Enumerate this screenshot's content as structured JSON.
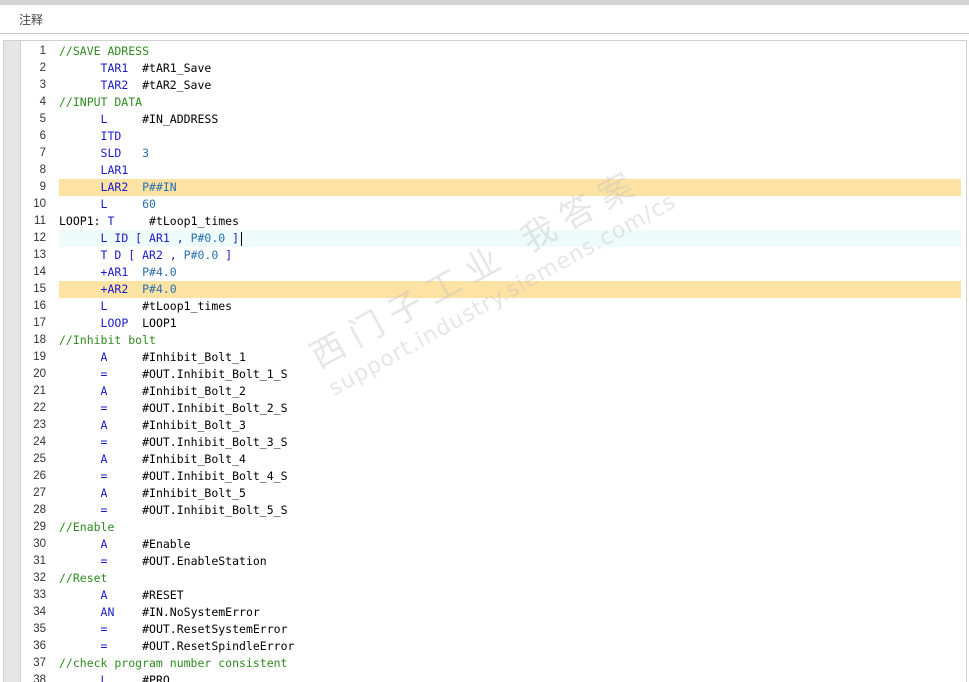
{
  "comment": {
    "label": "注释"
  },
  "code_lines": [
    {
      "n": "1",
      "seg": [
        {
          "t": "//SAVE ADRESS",
          "c": "comment"
        }
      ]
    },
    {
      "n": "2",
      "seg": [
        {
          "t": "      ",
          "c": "txt"
        },
        {
          "t": "TAR1",
          "c": "kw"
        },
        {
          "t": "  #tAR1_Save",
          "c": "txt"
        }
      ]
    },
    {
      "n": "3",
      "seg": [
        {
          "t": "      ",
          "c": "txt"
        },
        {
          "t": "TAR2",
          "c": "kw"
        },
        {
          "t": "  #tAR2_Save",
          "c": "txt"
        }
      ]
    },
    {
      "n": "4",
      "seg": [
        {
          "t": "//INPUT DATA",
          "c": "comment"
        }
      ]
    },
    {
      "n": "5",
      "seg": [
        {
          "t": "      ",
          "c": "txt"
        },
        {
          "t": "L",
          "c": "kw"
        },
        {
          "t": "     #IN_ADDRESS",
          "c": "txt"
        }
      ]
    },
    {
      "n": "6",
      "seg": [
        {
          "t": "      ",
          "c": "txt"
        },
        {
          "t": "ITD",
          "c": "kw"
        }
      ]
    },
    {
      "n": "7",
      "seg": [
        {
          "t": "      ",
          "c": "txt"
        },
        {
          "t": "SLD",
          "c": "kw"
        },
        {
          "t": "   ",
          "c": "txt"
        },
        {
          "t": "3",
          "c": "lit"
        }
      ]
    },
    {
      "n": "8",
      "seg": [
        {
          "t": "      ",
          "c": "txt"
        },
        {
          "t": "LAR1",
          "c": "kw"
        }
      ]
    },
    {
      "n": "9",
      "hl": true,
      "seg": [
        {
          "t": "      ",
          "c": "txt"
        },
        {
          "t": "LAR2",
          "c": "kw"
        },
        {
          "t": "  ",
          "c": "txt"
        },
        {
          "t": "P##IN",
          "c": "lit"
        }
      ]
    },
    {
      "n": "10",
      "seg": [
        {
          "t": "      ",
          "c": "txt"
        },
        {
          "t": "L",
          "c": "kw"
        },
        {
          "t": "     ",
          "c": "txt"
        },
        {
          "t": "60",
          "c": "lit"
        }
      ]
    },
    {
      "n": "11",
      "seg": [
        {
          "t": "LOOP1: ",
          "c": "txt"
        },
        {
          "t": "T",
          "c": "kw"
        },
        {
          "t": "     #tLoop1_times",
          "c": "txt"
        }
      ]
    },
    {
      "n": "12",
      "cur": true,
      "caret": true,
      "seg": [
        {
          "t": "      ",
          "c": "txt"
        },
        {
          "t": "L ID [ ",
          "c": "kw"
        },
        {
          "t": "AR1",
          "c": "kw"
        },
        {
          "t": " , ",
          "c": "kw"
        },
        {
          "t": "P#0.0",
          "c": "lit"
        },
        {
          "t": " ]",
          "c": "kw"
        }
      ]
    },
    {
      "n": "13",
      "seg": [
        {
          "t": "      ",
          "c": "txt"
        },
        {
          "t": "T D [ ",
          "c": "kw"
        },
        {
          "t": "AR2",
          "c": "kw"
        },
        {
          "t": " , ",
          "c": "kw"
        },
        {
          "t": "P#0.0",
          "c": "lit"
        },
        {
          "t": " ]",
          "c": "kw"
        }
      ]
    },
    {
      "n": "14",
      "seg": [
        {
          "t": "      ",
          "c": "txt"
        },
        {
          "t": "+AR1",
          "c": "kw"
        },
        {
          "t": "  ",
          "c": "txt"
        },
        {
          "t": "P#4.0",
          "c": "lit"
        }
      ]
    },
    {
      "n": "15",
      "hl": true,
      "seg": [
        {
          "t": "      ",
          "c": "txt"
        },
        {
          "t": "+AR2",
          "c": "kw"
        },
        {
          "t": "  ",
          "c": "txt"
        },
        {
          "t": "P#4.0",
          "c": "lit"
        }
      ]
    },
    {
      "n": "16",
      "seg": [
        {
          "t": "      ",
          "c": "txt"
        },
        {
          "t": "L",
          "c": "kw"
        },
        {
          "t": "     #tLoop1_times",
          "c": "txt"
        }
      ]
    },
    {
      "n": "17",
      "seg": [
        {
          "t": "      ",
          "c": "txt"
        },
        {
          "t": "LOOP",
          "c": "kw"
        },
        {
          "t": "  LOOP1",
          "c": "txt"
        }
      ]
    },
    {
      "n": "18",
      "seg": [
        {
          "t": "//Inhibit bolt",
          "c": "comment"
        }
      ]
    },
    {
      "n": "19",
      "seg": [
        {
          "t": "      ",
          "c": "txt"
        },
        {
          "t": "A",
          "c": "kw"
        },
        {
          "t": "     #Inhibit_Bolt_1",
          "c": "txt"
        }
      ]
    },
    {
      "n": "20",
      "seg": [
        {
          "t": "      ",
          "c": "txt"
        },
        {
          "t": "=",
          "c": "kw"
        },
        {
          "t": "     #OUT.Inhibit_Bolt_1_S",
          "c": "txt"
        }
      ]
    },
    {
      "n": "21",
      "seg": [
        {
          "t": "      ",
          "c": "txt"
        },
        {
          "t": "A",
          "c": "kw"
        },
        {
          "t": "     #Inhibit_Bolt_2",
          "c": "txt"
        }
      ]
    },
    {
      "n": "22",
      "seg": [
        {
          "t": "      ",
          "c": "txt"
        },
        {
          "t": "=",
          "c": "kw"
        },
        {
          "t": "     #OUT.Inhibit_Bolt_2_S",
          "c": "txt"
        }
      ]
    },
    {
      "n": "23",
      "seg": [
        {
          "t": "      ",
          "c": "txt"
        },
        {
          "t": "A",
          "c": "kw"
        },
        {
          "t": "     #Inhibit_Bolt_3",
          "c": "txt"
        }
      ]
    },
    {
      "n": "24",
      "seg": [
        {
          "t": "      ",
          "c": "txt"
        },
        {
          "t": "=",
          "c": "kw"
        },
        {
          "t": "     #OUT.Inhibit_Bolt_3_S",
          "c": "txt"
        }
      ]
    },
    {
      "n": "25",
      "seg": [
        {
          "t": "      ",
          "c": "txt"
        },
        {
          "t": "A",
          "c": "kw"
        },
        {
          "t": "     #Inhibit_Bolt_4",
          "c": "txt"
        }
      ]
    },
    {
      "n": "26",
      "seg": [
        {
          "t": "      ",
          "c": "txt"
        },
        {
          "t": "=",
          "c": "kw"
        },
        {
          "t": "     #OUT.Inhibit_Bolt_4_S",
          "c": "txt"
        }
      ]
    },
    {
      "n": "27",
      "seg": [
        {
          "t": "      ",
          "c": "txt"
        },
        {
          "t": "A",
          "c": "kw"
        },
        {
          "t": "     #Inhibit_Bolt_5",
          "c": "txt"
        }
      ]
    },
    {
      "n": "28",
      "seg": [
        {
          "t": "      ",
          "c": "txt"
        },
        {
          "t": "=",
          "c": "kw"
        },
        {
          "t": "     #OUT.Inhibit_Bolt_5_S",
          "c": "txt"
        }
      ]
    },
    {
      "n": "29",
      "seg": [
        {
          "t": "//Enable",
          "c": "comment"
        }
      ]
    },
    {
      "n": "30",
      "seg": [
        {
          "t": "      ",
          "c": "txt"
        },
        {
          "t": "A",
          "c": "kw"
        },
        {
          "t": "     #Enable",
          "c": "txt"
        }
      ]
    },
    {
      "n": "31",
      "seg": [
        {
          "t": "      ",
          "c": "txt"
        },
        {
          "t": "=",
          "c": "kw"
        },
        {
          "t": "     #OUT.EnableStation",
          "c": "txt"
        }
      ]
    },
    {
      "n": "32",
      "seg": [
        {
          "t": "//Reset",
          "c": "comment"
        }
      ]
    },
    {
      "n": "33",
      "seg": [
        {
          "t": "      ",
          "c": "txt"
        },
        {
          "t": "A",
          "c": "kw"
        },
        {
          "t": "     #RESET",
          "c": "txt"
        }
      ]
    },
    {
      "n": "34",
      "seg": [
        {
          "t": "      ",
          "c": "txt"
        },
        {
          "t": "AN",
          "c": "kw"
        },
        {
          "t": "    #IN.NoSystemError",
          "c": "txt"
        }
      ]
    },
    {
      "n": "35",
      "seg": [
        {
          "t": "      ",
          "c": "txt"
        },
        {
          "t": "=",
          "c": "kw"
        },
        {
          "t": "     #OUT.ResetSystemError",
          "c": "txt"
        }
      ]
    },
    {
      "n": "36",
      "seg": [
        {
          "t": "      ",
          "c": "txt"
        },
        {
          "t": "=",
          "c": "kw"
        },
        {
          "t": "     #OUT.ResetSpindleError",
          "c": "txt"
        }
      ]
    },
    {
      "n": "37",
      "seg": [
        {
          "t": "//check program number consistent",
          "c": "comment"
        }
      ]
    },
    {
      "n": "38",
      "seg": [
        {
          "t": "      ",
          "c": "txt"
        },
        {
          "t": "L",
          "c": "kw"
        },
        {
          "t": "     #PRO",
          "c": "txt"
        }
      ]
    }
  ],
  "watermark": {
    "line1": "西门子工业  我答案",
    "line2": "support.industry.siemens.com/cs"
  },
  "colors": {
    "comment": "#2e8b1f",
    "keyword": "#1a1ac8",
    "literal": "#2a6fb0",
    "highlight": "#fde3a3",
    "current_line": "#eefbfb"
  }
}
